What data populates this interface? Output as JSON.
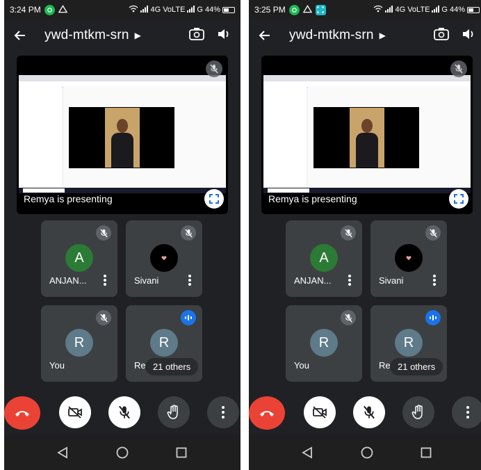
{
  "screens": [
    {
      "status_bar": {
        "time": "3:24 PM",
        "network": "4G VoLTE",
        "carrier2": "G",
        "battery": "44%"
      },
      "header": {
        "meeting_code": "ywd-mtkm-srn"
      },
      "presentation": {
        "label": "Remya is presenting"
      },
      "participants": [
        {
          "name": "ANJAN...",
          "initial": "A",
          "avatar_color": "#2b7a35",
          "muted": true
        },
        {
          "name": "Sivani",
          "initial": "",
          "avatar_color": "#000000",
          "muted": true
        },
        {
          "name": "You",
          "initial": "R",
          "avatar_color": "#5f7a89",
          "muted": true
        },
        {
          "name": "Rem",
          "initial": "R",
          "avatar_color": "#5f7a89",
          "speaking": true,
          "overflow_label": "21 others"
        }
      ]
    },
    {
      "status_bar": {
        "time": "3:25 PM",
        "network": "4G VoLTE",
        "carrier2": "G",
        "battery": "44%"
      },
      "header": {
        "meeting_code": "ywd-mtkm-srn"
      },
      "presentation": {
        "label": "Remya is presenting"
      },
      "participants": [
        {
          "name": "ANJAN...",
          "initial": "A",
          "avatar_color": "#2b7a35",
          "muted": true
        },
        {
          "name": "Sivani",
          "initial": "",
          "avatar_color": "#000000",
          "muted": true
        },
        {
          "name": "You",
          "initial": "R",
          "avatar_color": "#5f7a89",
          "muted": true
        },
        {
          "name": "Rem",
          "initial": "R",
          "avatar_color": "#5f7a89",
          "speaking": true,
          "overflow_label": "21 others"
        }
      ]
    }
  ],
  "icons": {
    "back": "arrow-left-icon",
    "title_caret": "caret-right-icon",
    "switch_camera": "switch-camera-icon",
    "speaker": "speaker-icon",
    "mic_off": "mic-off-icon",
    "fullscreen": "fullscreen-icon",
    "speaking": "audio-level-icon",
    "end_call": "phone-hangup-icon",
    "camera_off": "camera-off-icon",
    "raise_hand": "hand-icon",
    "more": "more-vert-icon"
  },
  "colors": {
    "end_call": "#ea4335",
    "speaking": "#1a73e8",
    "background": "#202124",
    "tile": "#3c4043"
  }
}
